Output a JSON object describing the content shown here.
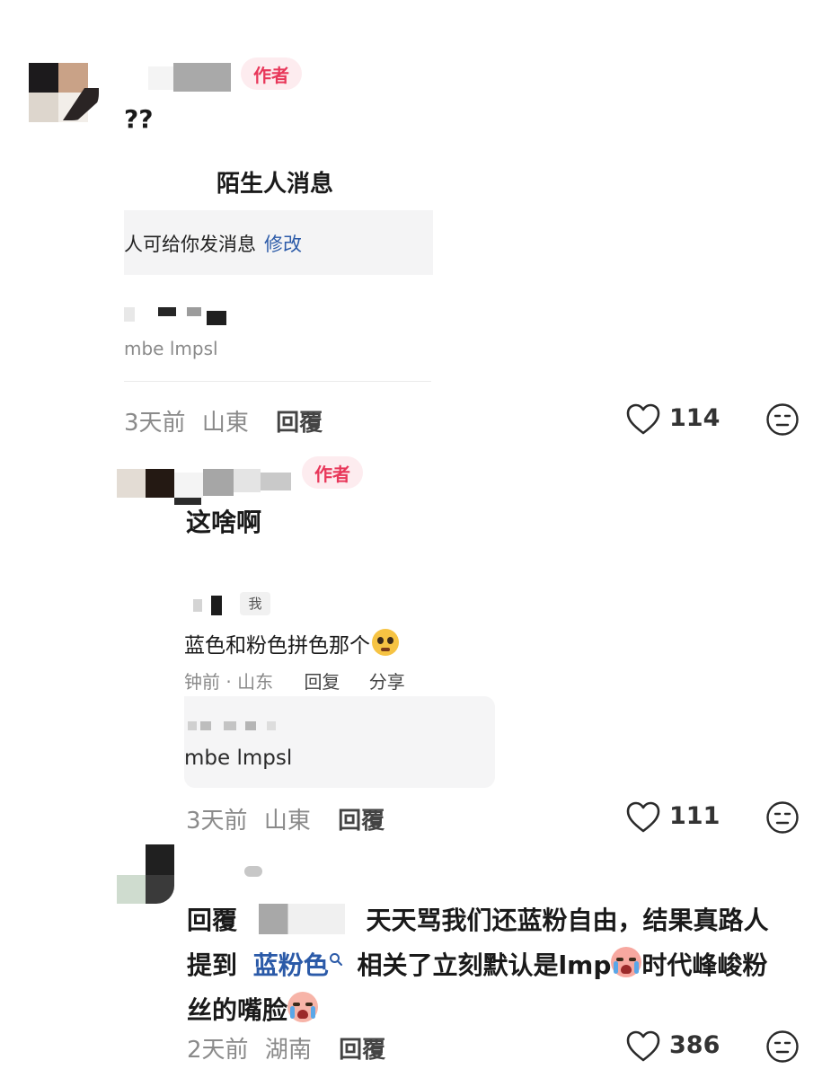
{
  "comments": [
    {
      "badge": "作者",
      "text": "??",
      "quote": {
        "title": "陌生人消息",
        "notice": "人可给你发消息",
        "edit": "修改",
        "subtext": "mbe lmpsl"
      },
      "time": "3天前",
      "location": "山東",
      "reply_label": "回覆",
      "likes": "114"
    },
    {
      "badge": "作者",
      "text": "这啥啊",
      "quote": {
        "me_badge": "我",
        "text": "蓝色和粉色拼色那个",
        "meta_time": "钟前 · 山东",
        "meta_reply": "回复",
        "meta_share": "分享",
        "subtext": "mbe lmpsl"
      },
      "time": "3天前",
      "location": "山東",
      "reply_label": "回覆",
      "likes": "111"
    },
    {
      "reply_prefix": "回覆",
      "line1": "天天骂我们还蓝粉自由，结果真路人",
      "line2_a": "提到",
      "link": "蓝粉色",
      "line2_b": "相关了立刻默认是",
      "line2_c": "lmp",
      "line2_d": "时代峰峻粉",
      "line3": "丝的嘴脸",
      "time": "2天前",
      "location": "湖南",
      "reply_label": "回覆",
      "likes": "386"
    }
  ],
  "colors": {
    "author_badge_text": "#e8375a",
    "author_badge_bg": "#fdecef",
    "link": "#2b5aa8",
    "meta_gray": "#8a8a8a"
  },
  "icons": [
    "heart-icon",
    "neutral-face-icon",
    "search-icon",
    "crying-emoji-icon"
  ]
}
